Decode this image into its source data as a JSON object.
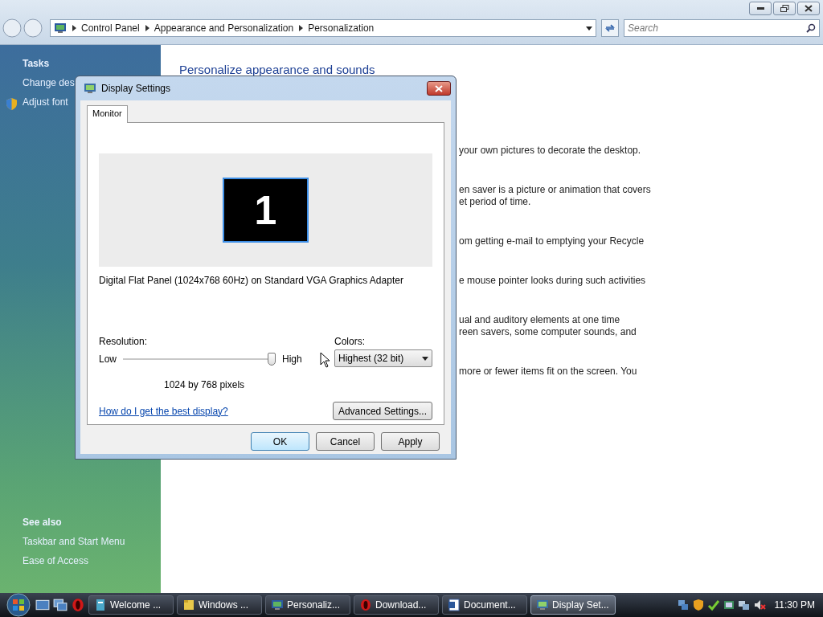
{
  "address_bar": {
    "crumbs": [
      "Control Panel",
      "Appearance and Personalization",
      "Personalization"
    ]
  },
  "search": {
    "placeholder": "Search"
  },
  "sidebar": {
    "tasks_title": "Tasks",
    "tasks": [
      "Change des",
      "Adjust font"
    ],
    "see_also_title": "See also",
    "see_also": [
      "Taskbar and Start Menu",
      "Ease of Access"
    ]
  },
  "content": {
    "heading": "Personalize appearance and sounds",
    "fragments": [
      [
        "your own pictures to decorate the desktop."
      ],
      [
        "en saver is a picture or animation that covers",
        "et period of time."
      ],
      [
        "om getting e-mail to emptying your Recycle"
      ],
      [
        "e mouse pointer looks during such activities"
      ],
      [
        "ual and auditory elements at one time",
        "reen savers, some computer sounds, and"
      ],
      [
        "more or fewer items fit on the screen. You"
      ]
    ]
  },
  "dialog": {
    "title": "Display Settings",
    "tabs": [
      {
        "label": "Monitor",
        "selected": true
      }
    ],
    "monitor_number": "1",
    "description": "Digital Flat Panel (1024x768 60Hz) on Standard VGA Graphics Adapter",
    "resolution": {
      "label": "Resolution:",
      "low": "Low",
      "high": "High",
      "level": 1,
      "reading": "1024 by 768 pixels"
    },
    "colors": {
      "label": "Colors:",
      "value": "Highest (32 bit)"
    },
    "help_link": "How do I get the best display?",
    "advanced_button": "Advanced Settings...",
    "buttons": [
      {
        "label": "OK",
        "default": true
      },
      {
        "label": "Cancel",
        "default": false
      },
      {
        "label": "Apply",
        "default": false
      }
    ]
  },
  "taskbar": {
    "tasks": [
      {
        "label": "Welcome ...",
        "selected": false
      },
      {
        "label": "Windows ...",
        "selected": false
      },
      {
        "label": "Personaliz...",
        "selected": false
      },
      {
        "label": "Download...",
        "selected": false
      },
      {
        "label": "Document...",
        "selected": false
      },
      {
        "label": "Display Set...",
        "selected": true
      }
    ],
    "clock": "11:30 PM"
  }
}
